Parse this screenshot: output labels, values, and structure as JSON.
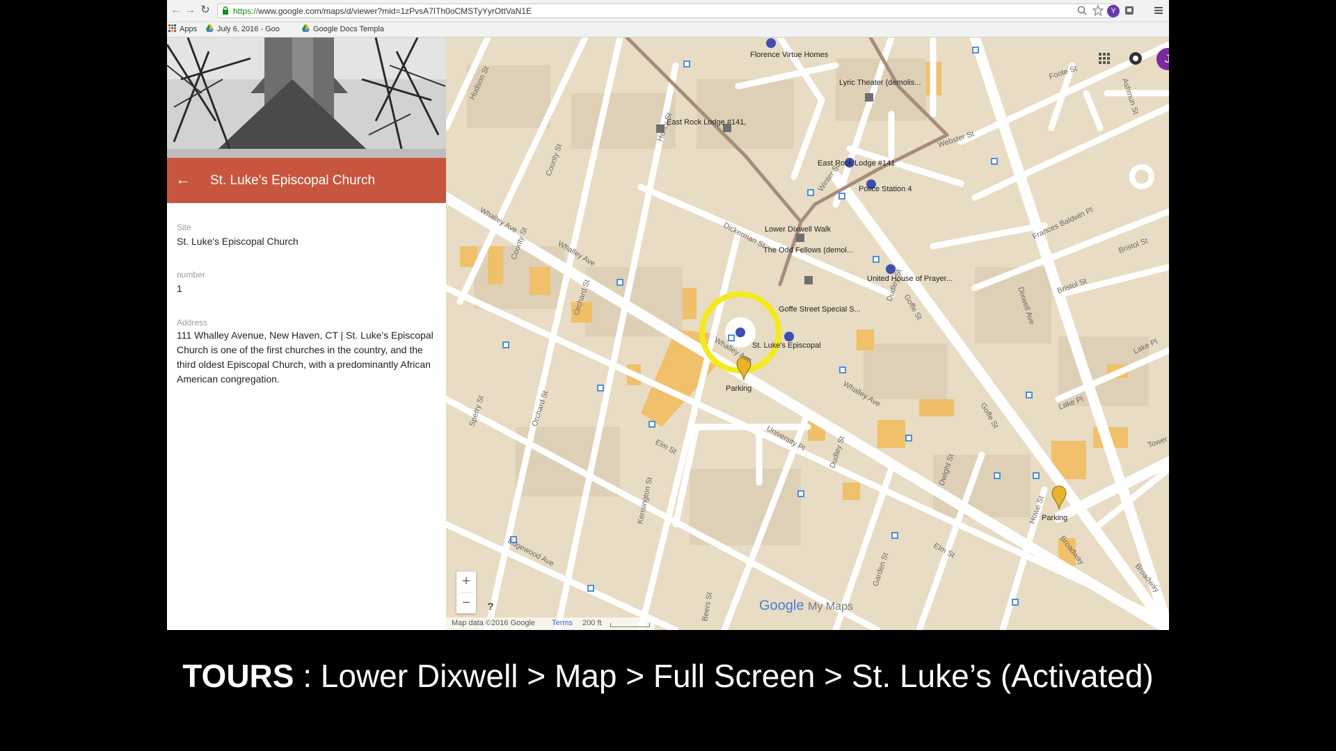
{
  "browser": {
    "url_protocol": "https://",
    "url_rest": "www.google.com/maps/d/viewer?mid=1zPvsA7ITh0oCMSTyYyrOttVaN1E",
    "avatar_letter": "Y",
    "bookmarks": [
      "Apps",
      "July 6, 2016 - Goo",
      "Google Docs Templa"
    ]
  },
  "panel": {
    "title": "St. Luke's Episcopal Church",
    "fields": [
      {
        "label": "Site",
        "value": "St. Luke's Episcopal Church"
      },
      {
        "label": "number",
        "value": "1"
      },
      {
        "label": "Address",
        "value": "111 Whalley Avenue, New Haven, CT | St. Luke's Episcopal Church is one of the first churches in the country, and the third oldest Episcopal Church, with a predominantly African American congregation."
      }
    ],
    "accent_color": "#c8563f"
  },
  "map": {
    "account_letter": "J",
    "account_color": "#7b2a9e",
    "places": [
      "Florence Virtue Homes",
      "Lyric Theater (demolis...",
      "East Rock Lodge #141,",
      "East Rock Lodge #141",
      "Police Station 4",
      "Lower Dixwell Walk",
      "The Odd Fellows (demol...",
      "United House of Prayer...",
      "Goffe Street Special S...",
      "St. Luke's Episcopal",
      "Parking",
      "Parking"
    ],
    "streets": [
      "Whalley Ave",
      "Whalley Ave",
      "Whalley Ave",
      "Whalley Ave",
      "Dickerman St",
      "Dixwell Ave",
      "Goffe St",
      "Goffe St",
      "Elm St",
      "Elm St",
      "Edgewood Ave",
      "Broadway",
      "Orchard St",
      "Orchard St",
      "Sperry St",
      "County St",
      "County St",
      "Dudley St",
      "Webster St",
      "Foote St",
      "Ashmun St",
      "Winter St",
      "Lake Pl",
      "Lake Pl",
      "Howe St",
      "Dwight St",
      "Garden St",
      "Frances Baldwin Pl",
      "University Pl",
      "Kensington St",
      "Beers St",
      "Henry St",
      "Bristol St",
      "Bristol St",
      "Hudson St",
      "Broadway",
      "Tower Pkwy",
      "Dudley St"
    ],
    "zoom_in": "+",
    "zoom_out": "−",
    "help": "?",
    "attribution": "Map data ©2016 Google",
    "terms": "Terms",
    "scale": "200 ft",
    "logo_google": "Google",
    "logo_mymaps": "My Maps"
  },
  "caption": {
    "bold": "TOURS",
    "rest": " : Lower Dixwell > Map > Full Screen > St. Luke’s (Activated)"
  }
}
